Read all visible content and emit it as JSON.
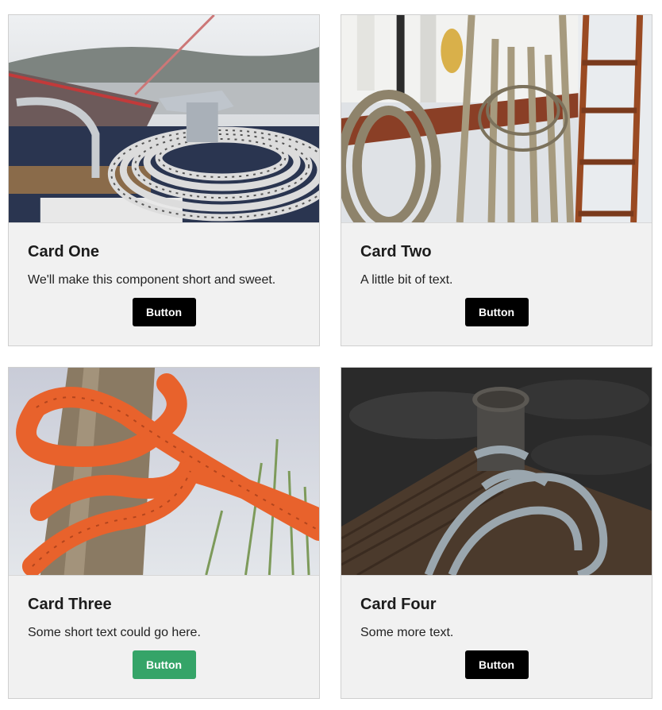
{
  "cards": [
    {
      "title": "Card One",
      "text": "We'll make this component short and sweet.",
      "button_label": "Button",
      "button_color": "#000000",
      "image_subject": "white rope coil on a boat deck"
    },
    {
      "title": "Card Two",
      "text": "A little bit of text.",
      "button_label": "Button",
      "button_color": "#000000",
      "image_subject": "hemp ropes hanging beside a wooden ladder"
    },
    {
      "title": "Card Three",
      "text": "Some short text could go here.",
      "button_label": "Button",
      "button_color": "#35a468",
      "image_subject": "orange rope knotted around a wooden post"
    },
    {
      "title": "Card Four",
      "text": "Some more text.",
      "button_label": "Button",
      "button_color": "#000000",
      "image_subject": "blue rope around a dock bollard"
    }
  ],
  "colors": {
    "card_background": "#f1f1f1",
    "card_border": "#cfcfcf",
    "button_default": "#000000",
    "button_highlighted": "#35a468"
  }
}
